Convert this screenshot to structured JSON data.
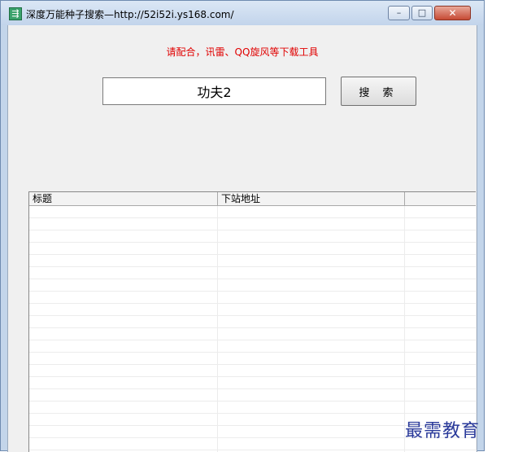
{
  "window": {
    "title": "深度万能种子搜索—http://52i52i.ys168.com/",
    "controls": {
      "minimize": "–",
      "maximize": "□",
      "close": "✕"
    }
  },
  "notice": "请配合，讯雷、QQ旋风等下载工具",
  "search": {
    "value": "功夫2",
    "button_label": "搜 索"
  },
  "results": {
    "columns": [
      "标题",
      "下站地址",
      ""
    ],
    "rows": []
  },
  "watermark": "最需教育",
  "colors": {
    "notice": "#e00000",
    "watermark": "#2a3a9a",
    "close_button": "#c64a34"
  }
}
